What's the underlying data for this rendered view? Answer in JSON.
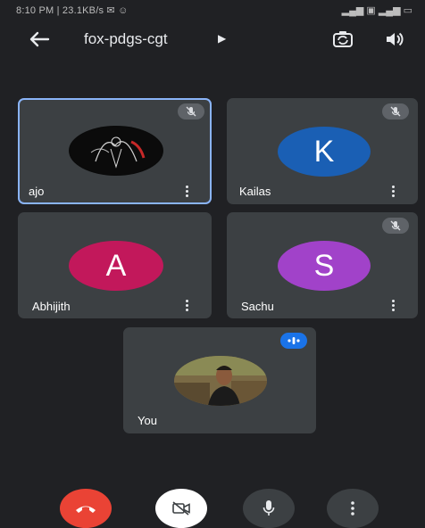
{
  "status_bar": {
    "left": "8:10 PM | 23.1KB/s ✉ ☺",
    "right": "▂▄▆ ▣ ▂▄▆ ▭"
  },
  "header": {
    "meeting_code": "fox-pdgs-cgt",
    "icons": {
      "back": "arrow-left-icon",
      "flip_camera": "flip-camera-icon",
      "speaker": "speaker-icon"
    }
  },
  "participants": [
    {
      "name": "ajo",
      "muted": true,
      "active": true,
      "avatar_type": "photo"
    },
    {
      "name": "Kailas",
      "muted": true,
      "avatar_letter": "K",
      "avatar_color": "#1a5fb4"
    },
    {
      "name": "Abhijith",
      "muted": false,
      "avatar_letter": "A",
      "avatar_color": "#c2185b"
    },
    {
      "name": "Sachu",
      "muted": true,
      "avatar_letter": "S",
      "avatar_color": "#a142c9"
    },
    {
      "name": "You",
      "speaking": true,
      "avatar_type": "photo"
    }
  ],
  "controls": {
    "end_call_color": "#ea4335",
    "camera_off_bg": "#ffffff",
    "dark_button_bg": "#3c4043",
    "active_border": "#8ab4f8"
  }
}
